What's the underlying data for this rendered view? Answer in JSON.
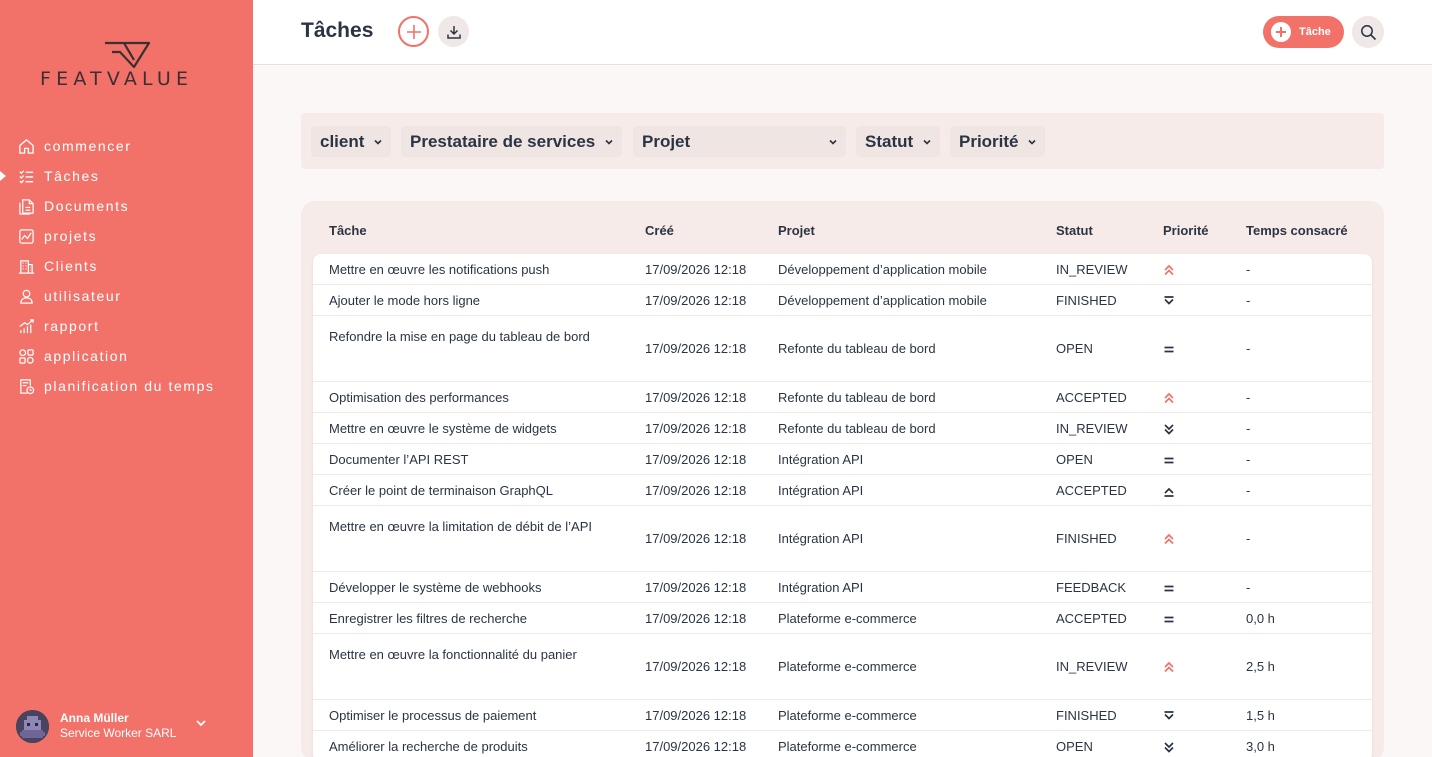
{
  "brand": {
    "logo_text": "FEATVALUE"
  },
  "sidebar": {
    "items": [
      {
        "label": "commencer",
        "icon": "home-icon"
      },
      {
        "label": "Tâches",
        "icon": "task-list-icon",
        "active": true
      },
      {
        "label": "Documents",
        "icon": "documents-icon"
      },
      {
        "label": "projets",
        "icon": "chart-icon"
      },
      {
        "label": "Clients",
        "icon": "building-icon"
      },
      {
        "label": "utilisateur",
        "icon": "user-icon"
      },
      {
        "label": "rapport",
        "icon": "report-icon"
      },
      {
        "label": "application",
        "icon": "apps-icon"
      },
      {
        "label": "planification du temps",
        "icon": "time-planning-icon"
      }
    ],
    "user": {
      "name": "Anna Müller",
      "company": "Service Worker SARL"
    }
  },
  "header": {
    "title": "Tâches",
    "new_task_label": "Tâche"
  },
  "filters": {
    "client": "client",
    "provider": "Prestataire de services",
    "project": "Projet",
    "status": "Statut",
    "priority": "Priorité"
  },
  "table": {
    "columns": {
      "task": "Tâche",
      "created": "Créé",
      "project": "Projet",
      "status": "Statut",
      "priority": "Priorité",
      "time": "Temps consacré"
    },
    "rows": [
      {
        "task": "Mettre en œuvre les notifications push",
        "created": "17/09/2026 12:18",
        "project": "Développement d’application mobile",
        "status": "IN_REVIEW",
        "priority": "highest",
        "time": "-"
      },
      {
        "task": "Ajouter le mode hors ligne",
        "created": "17/09/2026 12:18",
        "project": "Développement d’application mobile",
        "status": "FINISHED",
        "priority": "low",
        "time": "-"
      },
      {
        "task": "Refondre la mise en page du tableau de bord",
        "created": "17/09/2026 12:18",
        "project": "Refonte du tableau de bord",
        "status": "OPEN",
        "priority": "medium",
        "time": "-"
      },
      {
        "task": "Optimisation des performances",
        "created": "17/09/2026 12:18",
        "project": "Refonte du tableau de bord",
        "status": "ACCEPTED",
        "priority": "highest",
        "time": "-"
      },
      {
        "task": "Mettre en œuvre le système de widgets",
        "created": "17/09/2026 12:18",
        "project": "Refonte du tableau de bord",
        "status": "IN_REVIEW",
        "priority": "lowest",
        "time": "-"
      },
      {
        "task": "Documenter l’API REST",
        "created": "17/09/2026 12:18",
        "project": "Intégration API",
        "status": "OPEN",
        "priority": "medium",
        "time": "-"
      },
      {
        "task": "Créer le point de terminaison GraphQL",
        "created": "17/09/2026 12:18",
        "project": "Intégration API",
        "status": "ACCEPTED",
        "priority": "high",
        "time": "-"
      },
      {
        "task": "Mettre en œuvre la limitation de débit de l’API",
        "created": "17/09/2026 12:18",
        "project": "Intégration API",
        "status": "FINISHED",
        "priority": "highest",
        "time": "-"
      },
      {
        "task": "Développer le système de webhooks",
        "created": "17/09/2026 12:18",
        "project": "Intégration API",
        "status": "FEEDBACK",
        "priority": "medium",
        "time": "-"
      },
      {
        "task": "Enregistrer les filtres de recherche",
        "created": "17/09/2026 12:18",
        "project": "Plateforme e-commerce",
        "status": "ACCEPTED",
        "priority": "medium",
        "time": "0,0 h"
      },
      {
        "task": "Mettre en œuvre la fonctionnalité du panier",
        "created": "17/09/2026 12:18",
        "project": "Plateforme e-commerce",
        "status": "IN_REVIEW",
        "priority": "highest",
        "time": "2,5 h"
      },
      {
        "task": "Optimiser le processus de paiement",
        "created": "17/09/2026 12:18",
        "project": "Plateforme e-commerce",
        "status": "FINISHED",
        "priority": "low",
        "time": "1,5 h"
      },
      {
        "task": "Améliorer la recherche de produits",
        "created": "17/09/2026 12:18",
        "project": "Plateforme e-commerce",
        "status": "OPEN",
        "priority": "lowest",
        "time": "3,0 h"
      }
    ]
  },
  "colors": {
    "accent": "#f2726a",
    "text": "#2b3443",
    "muted_bg": "#f7ebe9"
  }
}
